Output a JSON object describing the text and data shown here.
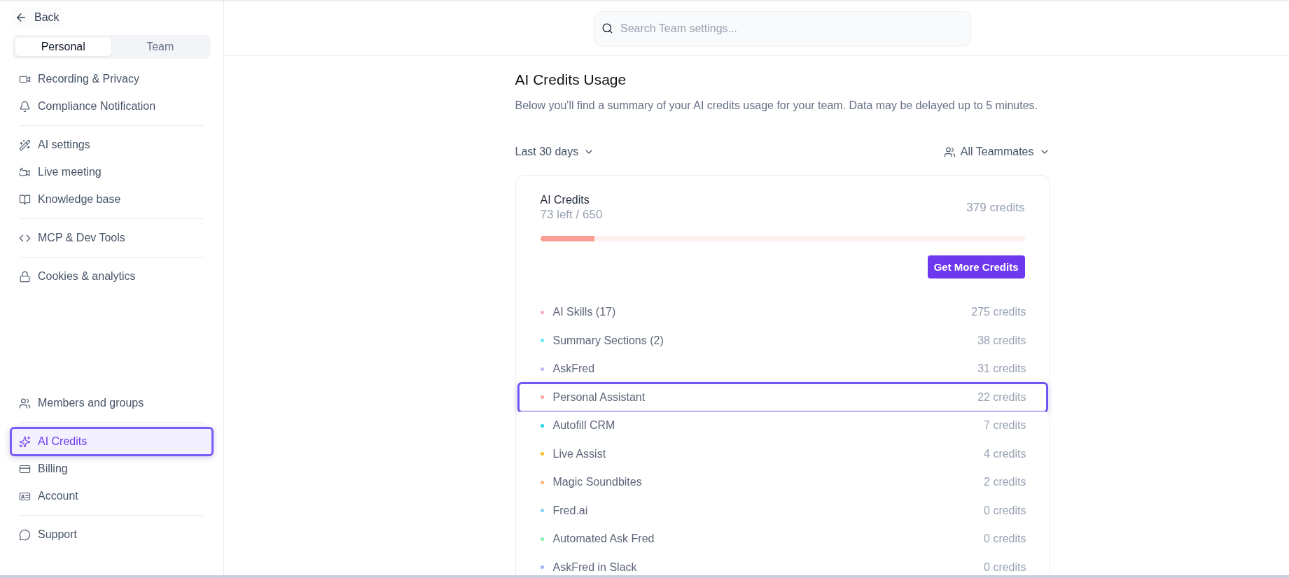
{
  "sidebar": {
    "back": "Back",
    "tabs": [
      {
        "label": "Personal",
        "selected": true
      },
      {
        "label": "Team",
        "selected": false
      }
    ],
    "top_sections": [
      [
        {
          "label": "Recording & Privacy",
          "selected": false,
          "highlighted": false
        },
        {
          "label": "Compliance Notification",
          "selected": false,
          "highlighted": false
        }
      ],
      [
        {
          "label": "AI settings",
          "selected": false,
          "highlighted": false
        },
        {
          "label": "Live meeting",
          "selected": false,
          "highlighted": false
        },
        {
          "label": "Knowledge base",
          "selected": false,
          "highlighted": false
        }
      ],
      [
        {
          "label": "MCP & Dev Tools",
          "selected": false,
          "highlighted": false
        }
      ],
      [
        {
          "label": "Cookies & analytics",
          "selected": false,
          "highlighted": false
        }
      ]
    ],
    "bottom_sections": [
      [
        {
          "label": "Members and groups",
          "selected": false,
          "highlighted": false
        }
      ],
      [
        {
          "label": "AI Credits",
          "selected": true,
          "highlighted": true
        },
        {
          "label": "Billing",
          "selected": false,
          "highlighted": false
        },
        {
          "label": "Account",
          "selected": false,
          "highlighted": false
        }
      ],
      [
        {
          "label": "Support",
          "selected": false,
          "highlighted": false
        }
      ]
    ]
  },
  "search": {
    "placeholder": "Search Team settings..."
  },
  "usage": {
    "title": "AI Credits Usage",
    "description": "Below you'll find a summary of your AI credits usage for your team. Data may be delayed up to 5 minutes.",
    "period_filter": "Last 30 days",
    "teammates_filter": "All Teammates",
    "card": {
      "title": "AI Credits",
      "remaining": "73 left / 650",
      "used": "379 credits",
      "level": 0.112,
      "button": "Get More Credits",
      "rows": [
        {
          "label": "AI Skills (17)",
          "credits": "275 credits",
          "color": "#f9a8d4",
          "highlighted": false
        },
        {
          "label": "Summary Sections (2)",
          "credits": "38 credits",
          "color": "#67e8f9",
          "highlighted": false
        },
        {
          "label": "AskFred",
          "credits": "31 credits",
          "color": "#c4b5fd",
          "highlighted": false
        },
        {
          "label": "Personal Assistant",
          "credits": "22 credits",
          "color": "#fca5a5",
          "highlighted": true
        },
        {
          "label": "Autofill CRM",
          "credits": "7 credits",
          "color": "#22d3ee",
          "highlighted": false
        },
        {
          "label": "Live Assist",
          "credits": "4 credits",
          "color": "#fbbf24",
          "highlighted": false
        },
        {
          "label": "Magic Soundbites",
          "credits": "2 credits",
          "color": "#fdba74",
          "highlighted": false
        },
        {
          "label": "Fred.ai",
          "credits": "0 credits",
          "color": "#7dd3fc",
          "highlighted": false
        },
        {
          "label": "Automated Ask Fred",
          "credits": "0 credits",
          "color": "#86efac",
          "highlighted": false
        },
        {
          "label": "AskFred in Slack",
          "credits": "0 credits",
          "color": "#a5b4fc",
          "highlighted": false
        }
      ]
    }
  }
}
